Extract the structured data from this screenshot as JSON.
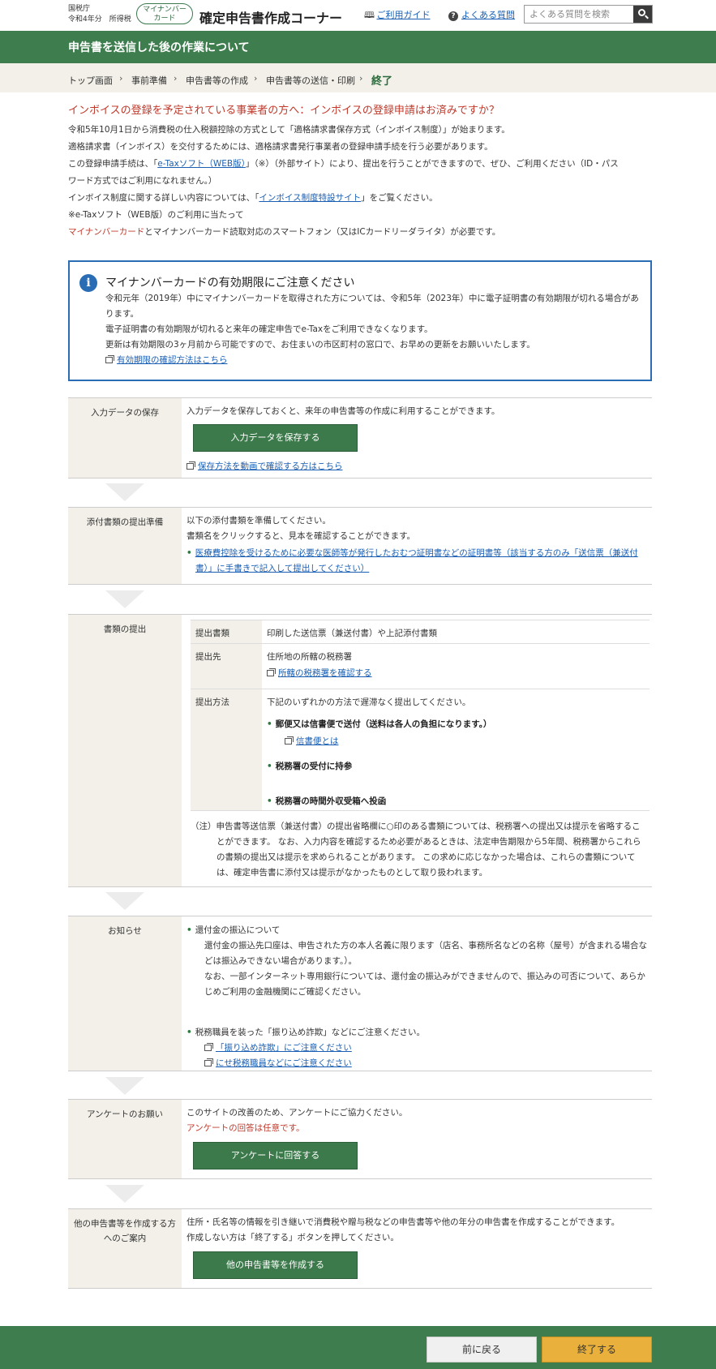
{
  "header": {
    "agency": "国税庁",
    "fiscal": "令和4年分　所得税",
    "myna_badge_line1": "マイナンバー",
    "myna_badge_line2": "カード",
    "site_title": "確定申告書作成コーナー",
    "guide_link": "ご利用ガイド",
    "faq_link": "よくある質問",
    "search_placeholder": "よくある質問を検索"
  },
  "page_title": "申告書を送信した後の作業について",
  "breadcrumb": {
    "items": [
      "トップ画面",
      "事前準備",
      "申告書等の作成",
      "申告書等の送信・印刷"
    ],
    "current": "終了"
  },
  "invoice": {
    "title": "インボイスの登録を予定されている事業者の方へ：インボイスの登録申請はお済みですか？",
    "p1": "令和5年10月1日から消費税の仕入税額控除の方式として「適格請求書保存方式（インボイス制度）」が始まります。",
    "p2": "適格請求書（インボイス）を交付するためには、適格請求書発行事業者の登録申請手続を行う必要があります。",
    "p3a": "この登録申請手続は、「",
    "p3_link": "e-Taxソフト（WEB版）",
    "p3b": "」（※）（外部サイト）により、提出を行うことができますので、ぜひ、ご利用ください（ID・パス",
    "p3c": "ワード方式ではご利用になれません。）",
    "p4a": "インボイス制度に関する詳しい内容については、「",
    "p4_link": "インボイス制度特設サイト",
    "p4b": "」をご覧ください。",
    "p5": "※e-Taxソフト（WEB版）のご利用に当たって",
    "p6_red": "マイナンバーカード",
    "p6b": "とマイナンバーカード読取対応のスマートフォン（又はICカードリーダライタ）が必要です。"
  },
  "notice": {
    "title": "マイナンバーカードの有効期限にご注意ください",
    "l1": "令和元年（2019年）中にマイナンバーカードを取得された方については、令和5年（2023年）中に電子証明書の有効期限が切れる場合があ",
    "l2": "ります。",
    "l3": "電子証明書の有効期限が切れると来年の確定申告でe-Taxをご利用できなくなります。",
    "l4": "更新は有効期限の3ヶ月前から可能ですので、お住まいの市区町村の窓口で、お早めの更新をお願いいたします。",
    "link": "有効期限の確認方法はこちら"
  },
  "save": {
    "label": "入力データの保存",
    "text": "入力データを保存しておくと、来年の申告書等の作成に利用することができます。",
    "button": "入力データを保存する",
    "link": "保存方法を動画で確認する方はこちら"
  },
  "attach": {
    "label": "添付書類の提出準備",
    "t1": "以下の添付書類を準備してください。",
    "t2": "書類名をクリックすると、見本を確認することができます。",
    "link1": "医療費控除を受けるために必要な医師等が発行したおむつ証明書などの証明書等（該当する方のみ「送信票（兼送付",
    "link2": "書）」に手書きで記入して提出してください）"
  },
  "submit": {
    "label": "書類の提出",
    "r1_label": "提出書類",
    "r1_text": "印刷した送信票（兼送付書）や上記添付書類",
    "r2_label": "提出先",
    "r2_text": "住所地の所轄の税務署",
    "r2_link": "所轄の税務署を確認する",
    "r3_label": "提出方法",
    "r3_text": "下記のいずれかの方法で遅滞なく提出してください。",
    "m1": "郵便又は信書便で送付（送料は各人の負担になります。）",
    "m1_link": "信書便とは",
    "m2": "税務署の受付に持参",
    "m3": "税務署の時間外収受箱へ投函",
    "note1": "（注）申告書等送信票（兼送付書）の提出省略欄に○印のある書類については、税務署への提出又は提示を省略するこ",
    "note2": "とができます。 なお、入力内容を確認するため必要があるときは、法定申告期限から5年間、税務署からこれら",
    "note3": "の書類の提出又は提示を求められることがあります。 この求めに応じなかった場合は、これらの書類について",
    "note4": "は、確定申告書に添付又は提示がなかったものとして取り扱われます。"
  },
  "info": {
    "label": "お知らせ",
    "b1": "還付金の振込について",
    "b1_l1": "還付金の振込先口座は、申告された方の本人名義に限ります（店名、事務所名などの名称（屋号）が含まれる場合な",
    "b1_l2": "どは振込みできない場合があります。）。",
    "b1_l3": "なお、一部インターネット専用銀行については、還付金の振込みができませんので、振込みの可否について、あらか",
    "b1_l4": "じめご利用の金融機関にご確認ください。",
    "b2": "税務職員を装った「振り込め詐欺」などにご注意ください。",
    "b2_link1": "「振り込め詐欺」にご注意ください",
    "b2_link2": "にせ税務職員などにご注意ください"
  },
  "survey": {
    "label": "アンケートのお願い",
    "t1": "このサイトの改善のため、アンケートにご協力ください。",
    "t2": "アンケートの回答は任意です。",
    "button": "アンケートに回答する"
  },
  "other": {
    "label1": "他の申告書等を作成する方",
    "label2": "へのご案内",
    "t1": "住所・氏名等の情報を引き継いで消費税や贈与税などの申告書等や他の年分の申告書を作成することができます。",
    "t2": "作成しない方は「終了する」ボタンを押してください。",
    "button": "他の申告書等を作成する"
  },
  "footer": {
    "back": "前に戻る",
    "end": "終了する"
  }
}
